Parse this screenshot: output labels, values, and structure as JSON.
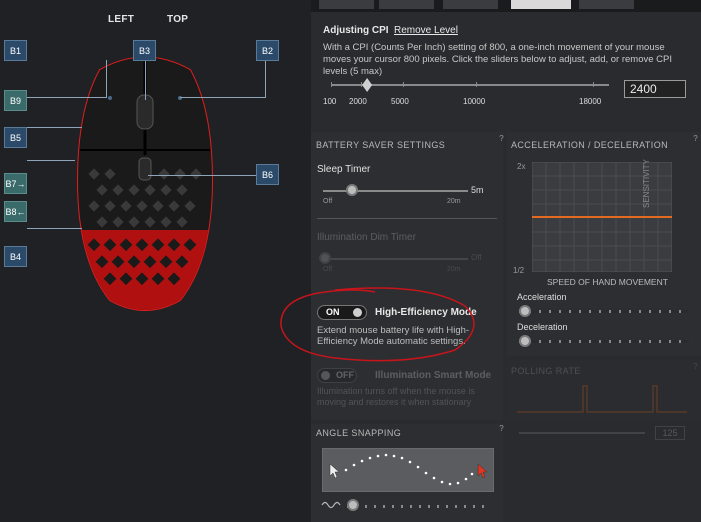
{
  "mouse_view": {
    "view_labels": {
      "left": "LEFT",
      "top": "TOP"
    },
    "buttons": [
      {
        "id": "B1",
        "label": "B1"
      },
      {
        "id": "B2",
        "label": "B2"
      },
      {
        "id": "B3",
        "label": "B3"
      },
      {
        "id": "B4",
        "label": "B4"
      },
      {
        "id": "B5",
        "label": "B5"
      },
      {
        "id": "B6",
        "label": "B6"
      },
      {
        "id": "B7",
        "label": "B7→"
      },
      {
        "id": "B8",
        "label": "B8←"
      },
      {
        "id": "B9",
        "label": "B9"
      }
    ],
    "colors": {
      "led": "#e11d1d",
      "shell": "#1c1c1c",
      "tag_blue": "#2b4a69",
      "tag_teal": "#3a6a6a"
    }
  },
  "cpi": {
    "title": "Adjusting CPI",
    "remove_link": "Remove Level",
    "description": "With a CPI (Counts Per Inch) setting of 800, a one-inch movement of your mouse moves your cursor 800 pixels. Click the sliders below to adjust, add, or remove CPI levels (5 max)",
    "scale_labels": [
      "100",
      "2000",
      "5000",
      "10000",
      "18000"
    ],
    "value": "2400",
    "slider_level": 0.13
  },
  "battery_saver": {
    "title": "BATTERY SAVER SETTINGS",
    "sleep_timer": {
      "label": "Sleep Timer",
      "min": "Off",
      "max": "20m",
      "value": "5m",
      "level": 0.2
    },
    "illumination_dim": {
      "label": "Illumination Dim Timer",
      "min": "Off",
      "max": "20m",
      "value": "Off"
    },
    "high_efficiency": {
      "toggle": "ON",
      "label": "High-Efficiency Mode",
      "description": "Extend mouse battery life with High-Efficiency Mode automatic settings."
    },
    "illumination_smart": {
      "toggle": "OFF",
      "label": "Illumination Smart Mode",
      "description": "Illumination turns off when the mouse is moving and restores it when stationary"
    }
  },
  "acceleration": {
    "title": "ACCELERATION / DECELERATION",
    "y_top": "2x",
    "y_bottom": "1/2",
    "y_axis": "SENSITIVITY",
    "x_axis": "SPEED OF HAND MOVEMENT",
    "acceleration_label": "Acceleration",
    "deceleration_label": "Deceleration",
    "line_color": "#e36a1e"
  },
  "polling_rate": {
    "title": "POLLING RATE",
    "value": "125"
  },
  "angle_snapping": {
    "title": "ANGLE SNAPPING"
  },
  "help": "?"
}
